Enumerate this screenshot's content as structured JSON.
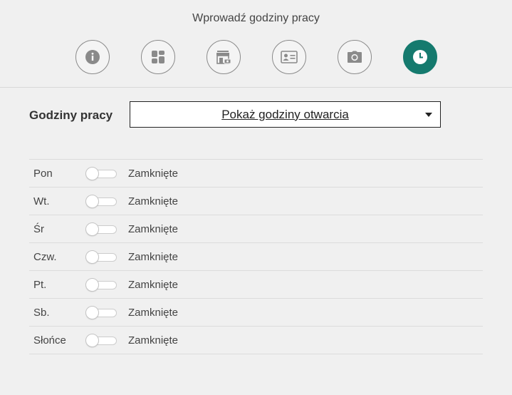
{
  "header": {
    "title": "Wprowadź godziny pracy"
  },
  "steps": [
    {
      "icon": "info-icon",
      "active": false
    },
    {
      "icon": "layout-icon",
      "active": false
    },
    {
      "icon": "store-icon",
      "active": false
    },
    {
      "icon": "contact-card-icon",
      "active": false
    },
    {
      "icon": "camera-icon",
      "active": false
    },
    {
      "icon": "clock-icon",
      "active": true
    }
  ],
  "hours": {
    "label": "Godziny pracy",
    "dropdown_value": "Pokaż godziny otwarcia"
  },
  "days": [
    {
      "name": "Pon",
      "status": "Zamknięte",
      "open": false
    },
    {
      "name": "Wt.",
      "status": "Zamknięte",
      "open": false
    },
    {
      "name": "Śr",
      "status": "Zamknięte",
      "open": false
    },
    {
      "name": "Czw.",
      "status": "Zamknięte",
      "open": false
    },
    {
      "name": "Pt.",
      "status": "Zamknięte",
      "open": false
    },
    {
      "name": "Sb.",
      "status": "Zamknięte",
      "open": false
    },
    {
      "name": "Słońce",
      "status": "Zamknięte",
      "open": false
    }
  ],
  "colors": {
    "accent": "#157a6e",
    "icon_gray": "#8a8a8a"
  }
}
